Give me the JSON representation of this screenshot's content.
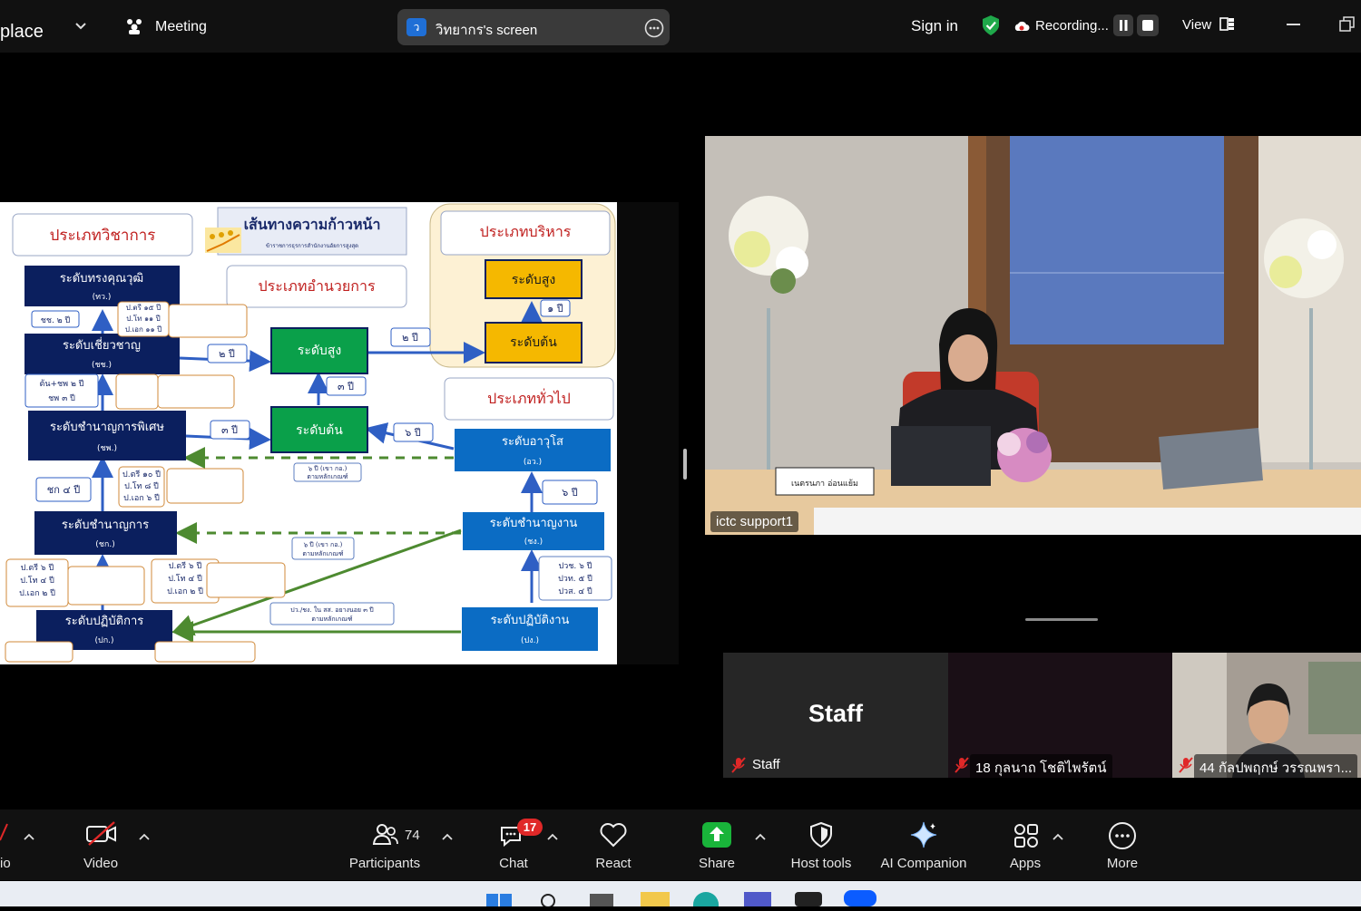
{
  "topbar": {
    "app_name_partial": "place",
    "meeting_label": "Meeting",
    "share_initial": "ว",
    "share_title": "วิทยากร's screen",
    "sign_in": "Sign in",
    "recording": "Recording...",
    "view": "View"
  },
  "slide": {
    "header_title": "เส้นทางความก้าวหน้า",
    "header_subtitle": "ข้าราชการธุรการสำนักงานอัยการสูงสุด",
    "cat_academic": "ประเภทวิชาการ",
    "cat_director": "ประเภทอำนวยการ",
    "cat_executive": "ประเภทบริหาร",
    "cat_general": "ประเภททั่วไป",
    "exec_high": "ระดับสูง",
    "exec_start": "ระดับต้น",
    "exec_gap": "๑ ปี",
    "dir_high": "ระดับสูง",
    "dir_start": "ระดับต้น",
    "dir_gap": "๓ ปี",
    "gap_2y": "๒ ปี",
    "gap_2y_b": "๒ ปี",
    "gap_3y": "๓ ปี",
    "gap_6y": "๖ ปี",
    "gap_6y_b": "๖ ปี",
    "gap_4y": "ชก ๔ ปี",
    "gap_cc2": "ชช. ๒ ปี",
    "gap_ton_ch": "ต้น+ชพ ๒ ปี",
    "gap_chp3": "ชพ ๓ ปี",
    "acad_1": "ระดับทรงคุณวุฒิ",
    "acad_1_abbr": "(ทว.)",
    "acad_2": "ระดับเชี่ยวชาญ",
    "acad_2_abbr": "(ชช.)",
    "acad_3": "ระดับชำนาญการพิเศษ",
    "acad_3_abbr": "(ชพ.)",
    "acad_4": "ระดับชำนาญการ",
    "acad_4_abbr": "(ชก.)",
    "acad_5": "ระดับปฏิบัติการ",
    "acad_5_abbr": "(ปก.)",
    "gen_1": "ระดับอาวุโส",
    "gen_1_abbr": "(อว.)",
    "gen_2": "ระดับชำนาญงาน",
    "gen_2_abbr": "(ชง.)",
    "gen_3": "ระดับปฏิบัติงาน",
    "gen_3_abbr": "(ปง.)",
    "note_a": "ป.ตรี ๑๕ ปี",
    "note_b": "ป.โท ๑๑ ปี",
    "note_c": "ป.เอก ๑๑ ปี",
    "note_d": "ป.ตรี ๑๐ ปี",
    "note_e": "ป.โท ๘ ปี",
    "note_f": "ป.เอก ๖ ปี",
    "note_g": "ป.ตรี ๖ ปี",
    "note_h": "ป.โท ๔ ปี",
    "note_i": "ป.เอก ๒ ปี",
    "note_j": "ปวช. ๖ ปี",
    "note_k": "ปวท. ๕ ปี",
    "note_l": "ปวส. ๔ ปี",
    "note_m": "๖ ปี (เขา กอ.)",
    "note_n": "ตามหลักเกณฑ์",
    "note_o": "ปว./ชง. ใน สส. อยางนอย ๓ ปี"
  },
  "video": {
    "participant_label": "ictc support1",
    "nameplate": "เนตรนภา อ่อนแย้ม"
  },
  "tiles": [
    {
      "avatar_text": "Staff",
      "name": "Staff"
    },
    {
      "name": "18 กุลนาถ โชติไพรัตน์"
    },
    {
      "name": "44 กัลปพฤกษ์ วรรณพรา..."
    }
  ],
  "toolbar": {
    "audio_partial": "io",
    "video": "Video",
    "participants": "Participants",
    "participants_count": "74",
    "chat": "Chat",
    "chat_badge": "17",
    "react": "React",
    "share": "Share",
    "host_tools": "Host tools",
    "ai_companion": "AI Companion",
    "apps": "Apps",
    "more": "More"
  },
  "colors": {
    "navy": "#0b1f5e",
    "green": "#0aa04a",
    "gold": "#f5b800",
    "blue": "#0b6cc4",
    "share_green": "#19b43a",
    "badge_red": "#e02828"
  }
}
